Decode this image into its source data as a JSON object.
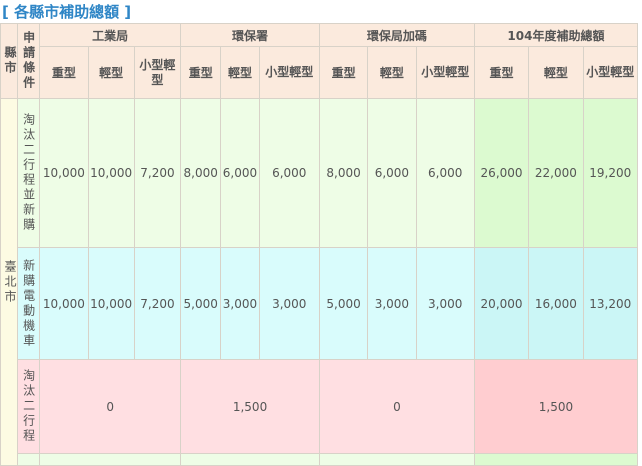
{
  "title": "[ 各縣市補助總額 ]",
  "header": {
    "city": "縣市",
    "condition": "申請條件",
    "groups": [
      "工業局",
      "環保署",
      "環保局加碼",
      "104年度補助總額"
    ],
    "sub": {
      "heavy": "重型",
      "light": "輕型",
      "small_light": "小型輕型"
    }
  },
  "city": "臺北市",
  "rows": [
    {
      "condition": "淘汰二行程並新購",
      "industry": [
        "10,000",
        "10,000",
        "7,200"
      ],
      "epa": [
        "8,000",
        "6,000",
        "6,000"
      ],
      "local": [
        "8,000",
        "6,000",
        "6,000"
      ],
      "total": [
        "26,000",
        "22,000",
        "19,200"
      ]
    },
    {
      "condition": "新購電動機車",
      "industry": [
        "10,000",
        "10,000",
        "7,200"
      ],
      "epa": [
        "5,000",
        "3,000",
        "3,000"
      ],
      "local": [
        "5,000",
        "3,000",
        "3,000"
      ],
      "total": [
        "20,000",
        "16,000",
        "13,200"
      ]
    },
    {
      "condition": "淘汰二行程",
      "industry": "0",
      "epa": "1,500",
      "local": "0",
      "total": "1,500"
    }
  ],
  "colors": {
    "title": "#2f86c6",
    "header_bg": "#fbeadd",
    "row1": "#eefde6",
    "row2": "#d9fcfc",
    "row3": "#ffdfe2"
  }
}
